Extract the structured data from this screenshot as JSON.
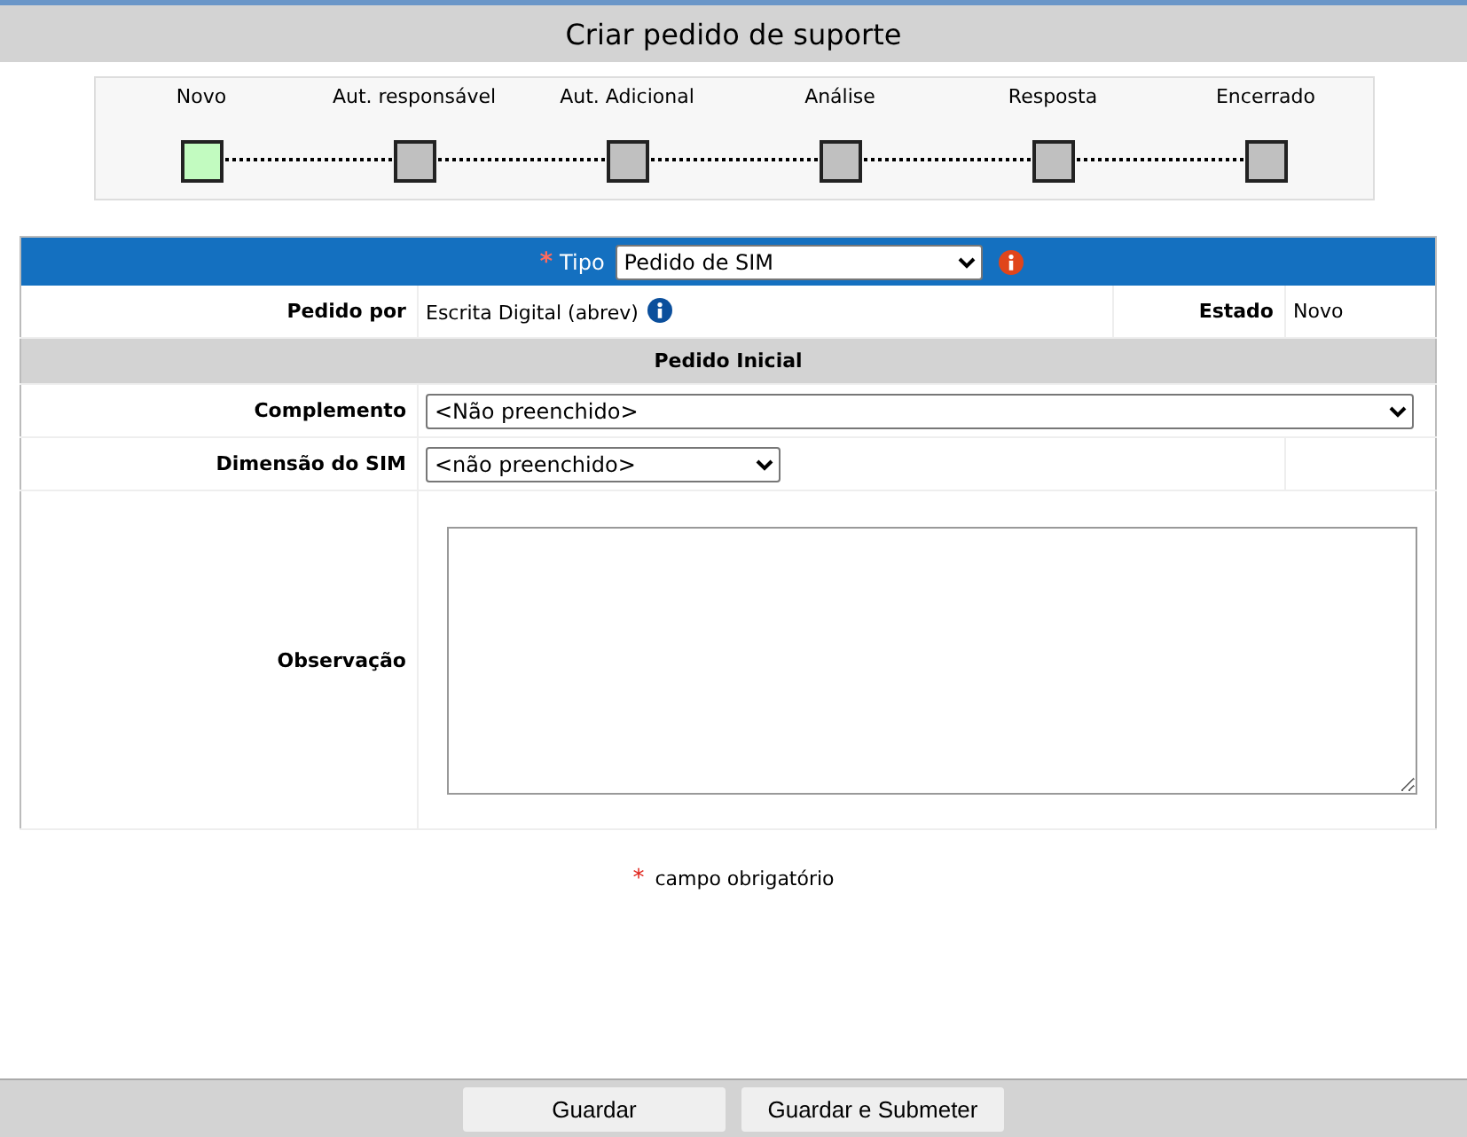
{
  "title": "Criar pedido de suporte",
  "workflow": [
    {
      "label": "Novo",
      "current": true
    },
    {
      "label": "Aut. responsável",
      "current": false
    },
    {
      "label": "Aut. Adicional",
      "current": false
    },
    {
      "label": "Análise",
      "current": false
    },
    {
      "label": "Resposta",
      "current": false
    },
    {
      "label": "Encerrado",
      "current": false
    }
  ],
  "form": {
    "tipo": {
      "required_mark": "*",
      "label": "Tipo",
      "value": "Pedido de SIM"
    },
    "pedido_por": {
      "label": "Pedido por",
      "value": "Escrita Digital (abrev)"
    },
    "estado": {
      "label": "Estado",
      "value": "Novo"
    },
    "section": "Pedido Inicial",
    "fields": [
      {
        "kind": "select",
        "wide": true,
        "label": "Complemento",
        "value": "<Não preenchido>"
      },
      {
        "kind": "select",
        "wide": false,
        "label": "Dimensão do SIM",
        "value": "<não preenchido>"
      },
      {
        "kind": "textarea",
        "label": "Observação"
      }
    ]
  },
  "required_note": {
    "mark": "*",
    "text": "campo obrigatório"
  },
  "buttons": [
    "Guardar",
    "Guardar e Submeter"
  ]
}
